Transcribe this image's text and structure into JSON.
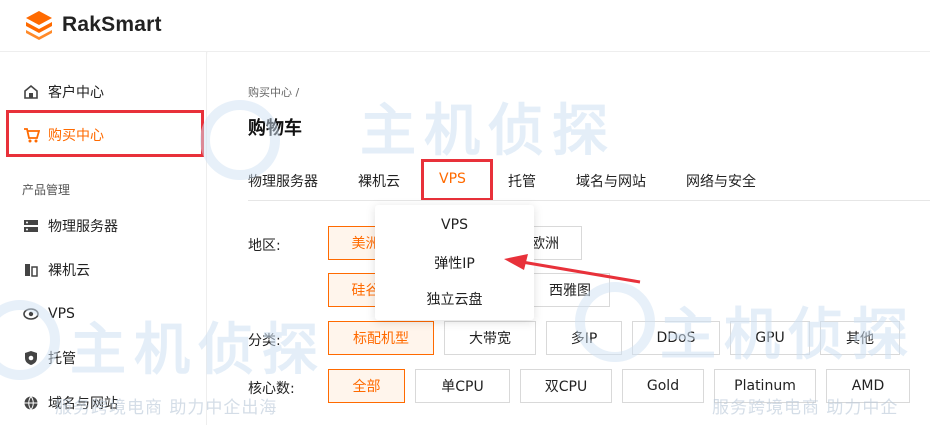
{
  "brand": {
    "name": "RakSmart",
    "accent": "#ff6a00",
    "highlight": "#e8313a"
  },
  "sidebar": {
    "items": [
      {
        "label": "客户中心",
        "icon": "home-icon"
      },
      {
        "label": "购买中心",
        "icon": "cart-icon",
        "active": true
      }
    ],
    "section_title": "产品管理",
    "products": [
      {
        "label": "物理服务器",
        "icon": "server-icon"
      },
      {
        "label": "裸机云",
        "icon": "bare-metal-icon"
      },
      {
        "label": "VPS",
        "icon": "vps-icon"
      },
      {
        "label": "托管",
        "icon": "shield-icon"
      },
      {
        "label": "域名与网站",
        "icon": "globe-icon"
      }
    ]
  },
  "main": {
    "breadcrumb": "购买中心  /",
    "title": "购物车",
    "tabs": [
      {
        "label": "物理服务器"
      },
      {
        "label": "裸机云"
      },
      {
        "label": "VPS",
        "active": true
      },
      {
        "label": "托管"
      },
      {
        "label": "域名与网站"
      },
      {
        "label": "网络与安全"
      }
    ],
    "region": {
      "label": "地区:",
      "options": [
        "美洲",
        "欧洲",
        "硅谷",
        "西雅图"
      ]
    },
    "category": {
      "label": "分类:",
      "options": [
        "标配机型",
        "大带宽",
        "多IP",
        "DDoS",
        "GPU",
        "其他"
      ]
    },
    "cores": {
      "label": "核心数:",
      "options": [
        "全部",
        "单CPU",
        "双CPU",
        "Gold",
        "Platinum",
        "AMD"
      ]
    }
  },
  "dropdown": {
    "items": [
      "VPS",
      "弹性IP",
      "独立云盘"
    ]
  },
  "watermark": {
    "big": "主机侦探",
    "small_left": "服务跨境电商 助力中企出海",
    "small_right": "服务跨境电商 助力中企"
  }
}
